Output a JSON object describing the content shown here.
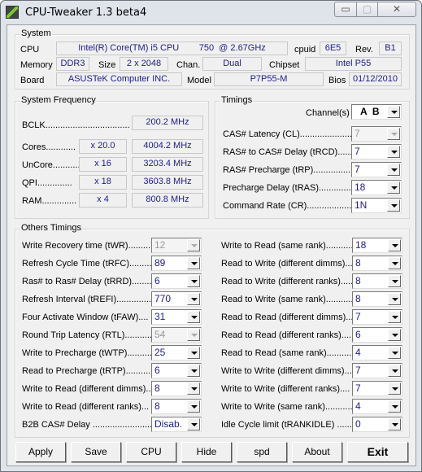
{
  "window": {
    "title": "CPU-Tweaker 1.3 beta4",
    "minimize": "▭",
    "maximize": "▢",
    "close": "✕"
  },
  "system": {
    "title": "System",
    "cpu_label": "CPU",
    "cpu": "Intel(R) Core(TM) i5 CPU        750  @ 2.67GHz",
    "cpuid_label": "cpuid",
    "cpuid": "6E5",
    "rev_label": "Rev.",
    "rev": "B1",
    "memory_label": "Memory",
    "memory": "DDR3",
    "size_label": "Size",
    "size": "2 x 2048",
    "chan_label": "Chan.",
    "chan": "Dual",
    "chipset_label": "Chipset",
    "chipset": "Intel P55",
    "board_label": "Board",
    "board": "ASUSTeK Computer INC.",
    "model_label": "Model",
    "model": "P7P55-M",
    "bios_label": "Bios",
    "bios": "01/12/2010"
  },
  "frequency": {
    "title": "System Frequency",
    "bclk_label": "BCLK..................................",
    "bclk": "200.2 MHz",
    "rows": [
      {
        "label": "Cores............",
        "mult": "x 20.0",
        "value": "4004.2 MHz"
      },
      {
        "label": "UnCore...........",
        "mult": "x 16",
        "value": "3203.4 MHz"
      },
      {
        "label": "QPI..............",
        "mult": "x 18",
        "value": "3603.8 MHz"
      },
      {
        "label": "RAM..............",
        "mult": "x 4",
        "value": "800.8 MHz"
      }
    ]
  },
  "timings": {
    "title": "Timings",
    "channels_label": "Channel(s)",
    "channels": "A  B",
    "rows": [
      {
        "label": "CAS# Latency (CL)......................",
        "value": "7",
        "disabled": true
      },
      {
        "label": "RAS# to CAS# Delay (tRCD).......",
        "value": "7"
      },
      {
        "label": "RAS# Precharge (tRP)..................",
        "value": "7"
      },
      {
        "label": "Precharge Delay (tRAS)..............",
        "value": "18"
      },
      {
        "label": "Command Rate (CR)....................",
        "value": "1N"
      }
    ]
  },
  "others": {
    "title": "Others Timings",
    "left": [
      {
        "label": "Write Recovery time (tWR).........",
        "value": "12",
        "disabled": true
      },
      {
        "label": "Refresh Cycle Time (tRFC).........",
        "value": "89"
      },
      {
        "label": "Ras# to Ras# Delay (tRRD).........",
        "value": "6"
      },
      {
        "label": "Refresh Interval (tREFI)..............",
        "value": "770"
      },
      {
        "label": "Four Activate Window (tFAW)....",
        "value": "31"
      },
      {
        "label": "Round Trip Latency (RTL)...........",
        "value": "54",
        "disabled": true
      },
      {
        "label": "Write to Precharge (tWTP)..........",
        "value": "25"
      },
      {
        "label": "Read to Precharge (tRTP)...........",
        "value": "6"
      },
      {
        "label": "Write to Read (different dimms)...",
        "value": "8"
      },
      {
        "label": "Write to Read (different ranks)...",
        "value": "8"
      },
      {
        "label": "B2B CAS# Delay ........................",
        "value": "Disab."
      }
    ],
    "right": [
      {
        "label": "Write to Read (same rank)...........",
        "value": "18"
      },
      {
        "label": "Read to Write (different dimms)....",
        "value": "8"
      },
      {
        "label": "Read to Write (different ranks).....",
        "value": "8"
      },
      {
        "label": "Read to Write (same rank)...........",
        "value": "8"
      },
      {
        "label": "Read to Read (different dimms)...",
        "value": "7"
      },
      {
        "label": "Read to Read (different ranks)....",
        "value": "6"
      },
      {
        "label": "Read to Read (same rank)..........",
        "value": "4"
      },
      {
        "label": "Write to Write (different dimms)...",
        "value": "7"
      },
      {
        "label": "Write to Write (different ranks)....",
        "value": "7"
      },
      {
        "label": "Write to Write (same rank)...........",
        "value": "4"
      },
      {
        "label": "Idle Cycle limit (tRANKIDLE) .........",
        "value": "0"
      }
    ]
  },
  "buttons": [
    "Apply",
    "Save",
    "CPU",
    "Hide",
    "spd",
    "About",
    "Exit"
  ]
}
